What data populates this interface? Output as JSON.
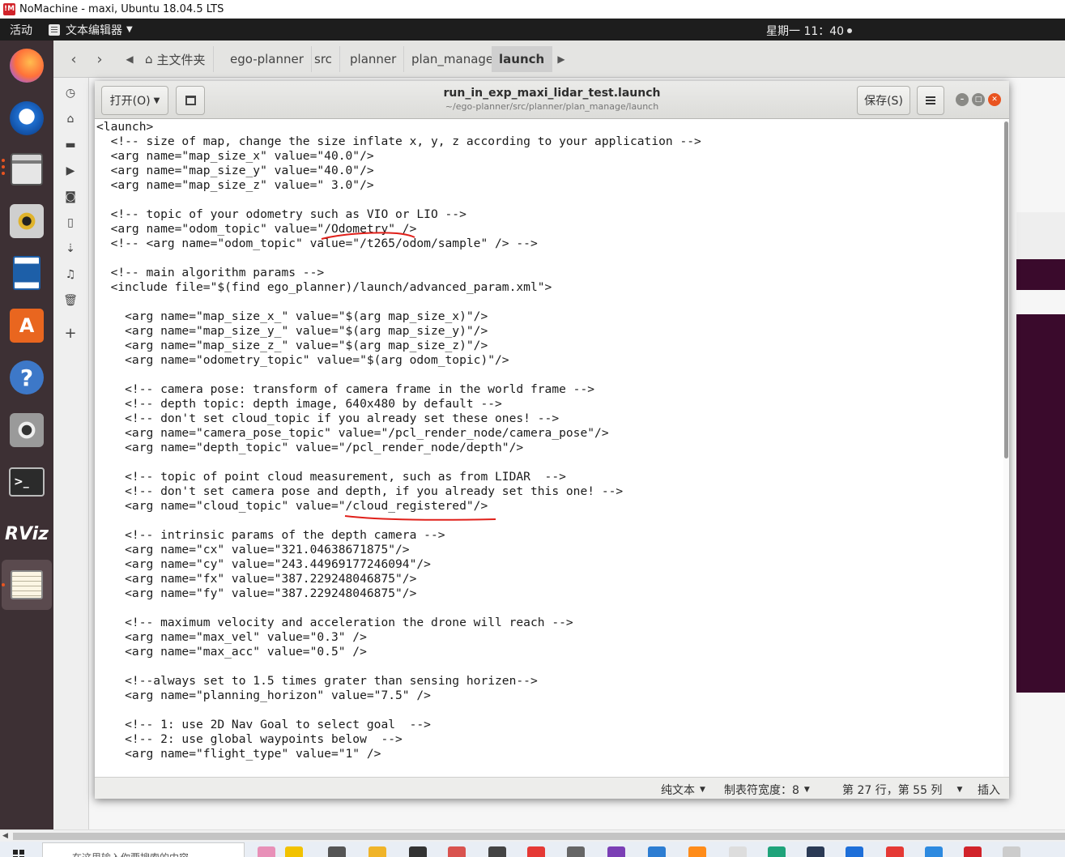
{
  "nomachine": {
    "title": "NoMachine - maxi, Ubuntu 18.04.5 LTS",
    "logo": "!M"
  },
  "topbar": {
    "activities": "活动",
    "app_menu": "文本编辑器",
    "clock": "星期一 11：40"
  },
  "files": {
    "crumbs": [
      "主文件夹",
      "ego-planner",
      "src",
      "planner",
      "plan_manage",
      "launch"
    ]
  },
  "gedit": {
    "open_label": "打开(O)",
    "title": "run_in_exp_maxi_lidar_test.launch",
    "path": "~/ego-planner/src/planner/plan_manage/launch",
    "save_label": "保存(S)",
    "status": {
      "lang": "纯文本",
      "tab_width": "制表符宽度：8",
      "position": "第 27 行，第 55 列",
      "mode": "插入"
    },
    "lines": [
      "<launch>",
      "  <!-- size of map, change the size inflate x, y, z according to your application -->",
      "  <arg name=\"map_size_x\" value=\"40.0\"/>",
      "  <arg name=\"map_size_y\" value=\"40.0\"/>",
      "  <arg name=\"map_size_z\" value=\" 3.0\"/>",
      "",
      "  <!-- topic of your odometry such as VIO or LIO -->",
      "  <arg name=\"odom_topic\" value=\"/Odometry\" />",
      "  <!-- <arg name=\"odom_topic\" value=\"/t265/odom/sample\" /> -->",
      "",
      "  <!-- main algorithm params -->",
      "  <include file=\"$(find ego_planner)/launch/advanced_param.xml\">",
      "",
      "    <arg name=\"map_size_x_\" value=\"$(arg map_size_x)\"/>",
      "    <arg name=\"map_size_y_\" value=\"$(arg map_size_y)\"/>",
      "    <arg name=\"map_size_z_\" value=\"$(arg map_size_z)\"/>",
      "    <arg name=\"odometry_topic\" value=\"$(arg odom_topic)\"/>",
      "",
      "    <!-- camera pose: transform of camera frame in the world frame -->",
      "    <!-- depth topic: depth image, 640x480 by default -->",
      "    <!-- don't set cloud_topic if you already set these ones! -->",
      "    <arg name=\"camera_pose_topic\" value=\"/pcl_render_node/camera_pose\"/>",
      "    <arg name=\"depth_topic\" value=\"/pcl_render_node/depth\"/>",
      "",
      "    <!-- topic of point cloud measurement, such as from LIDAR  -->",
      "    <!-- don't set camera pose and depth, if you already set this one! -->",
      "    <arg name=\"cloud_topic\" value=\"/cloud_registered\"/>",
      "",
      "    <!-- intrinsic params of the depth camera -->",
      "    <arg name=\"cx\" value=\"321.04638671875\"/>",
      "    <arg name=\"cy\" value=\"243.44969177246094\"/>",
      "    <arg name=\"fx\" value=\"387.229248046875\"/>",
      "    <arg name=\"fy\" value=\"387.229248046875\"/>",
      "",
      "    <!-- maximum velocity and acceleration the drone will reach -->",
      "    <arg name=\"max_vel\" value=\"0.3\" />",
      "    <arg name=\"max_acc\" value=\"0.5\" />",
      "",
      "    <!--always set to 1.5 times grater than sensing horizen-->",
      "    <arg name=\"planning_horizon\" value=\"7.5\" />",
      "",
      "    <!-- 1: use 2D Nav Goal to select goal  -->",
      "    <!-- 2: use global waypoints below  -->",
      "    <arg name=\"flight_type\" value=\"1\" />"
    ]
  },
  "dock": {
    "rviz_label": "RViz"
  },
  "taskbar": {
    "search_placeholder": "在这里输入你要搜索的内容"
  },
  "colors": {
    "annotation": "#e0201a",
    "ubuntu_accent": "#e95420"
  }
}
